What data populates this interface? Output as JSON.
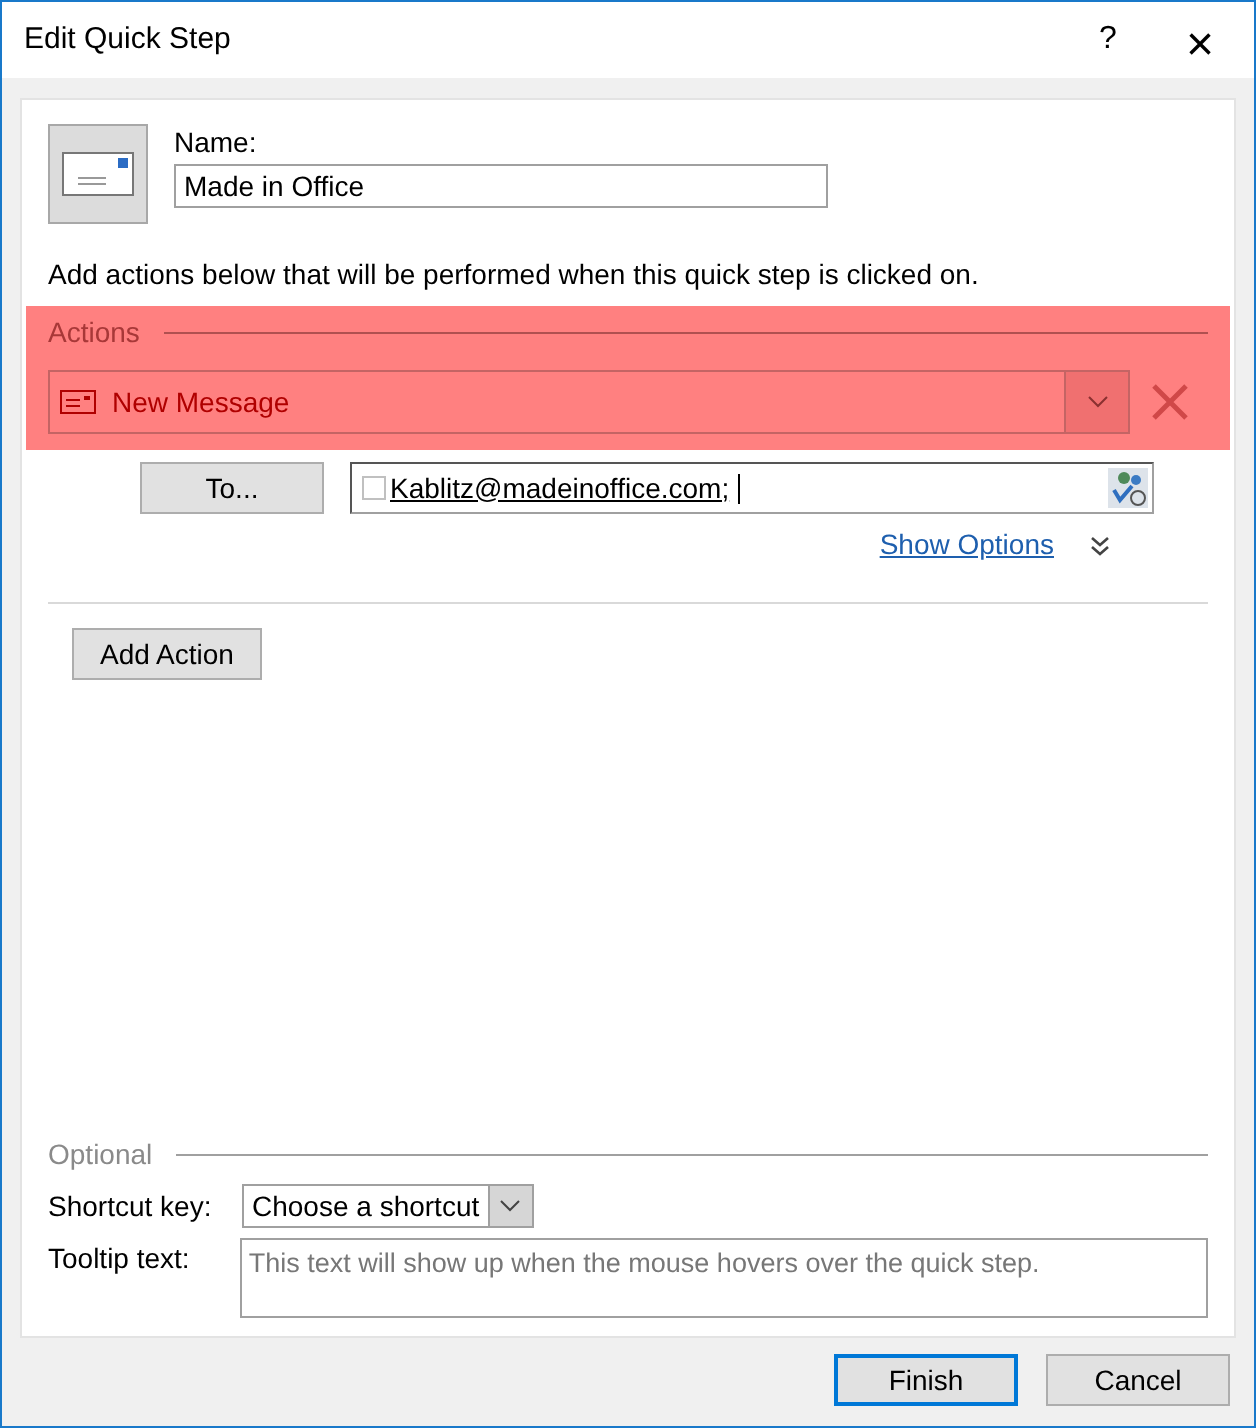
{
  "window": {
    "title": "Edit Quick Step",
    "help": "?",
    "close": "×"
  },
  "name": {
    "label": "Name:",
    "value": "Made in Office"
  },
  "instruction": "Add actions below that will be performed when this quick step is clicked on.",
  "actions": {
    "heading": "Actions",
    "highlighted": true,
    "items": [
      {
        "kind": "new-message",
        "label": "New Message",
        "to_button": "To...",
        "recipients": "Kablitz@madeinoffice.com;",
        "recipient_checked": false,
        "show_options": "Show Options"
      }
    ],
    "add_button": "Add Action"
  },
  "optional": {
    "heading": "Optional",
    "shortcut_label": "Shortcut key:",
    "shortcut_value": "Choose a shortcut",
    "tooltip_label": "Tooltip text:",
    "tooltip_placeholder": "This text will show up when the mouse hovers over the quick step."
  },
  "buttons": [
    {
      "label": "Finish",
      "default": true
    },
    {
      "label": "Cancel",
      "default": false
    }
  ]
}
